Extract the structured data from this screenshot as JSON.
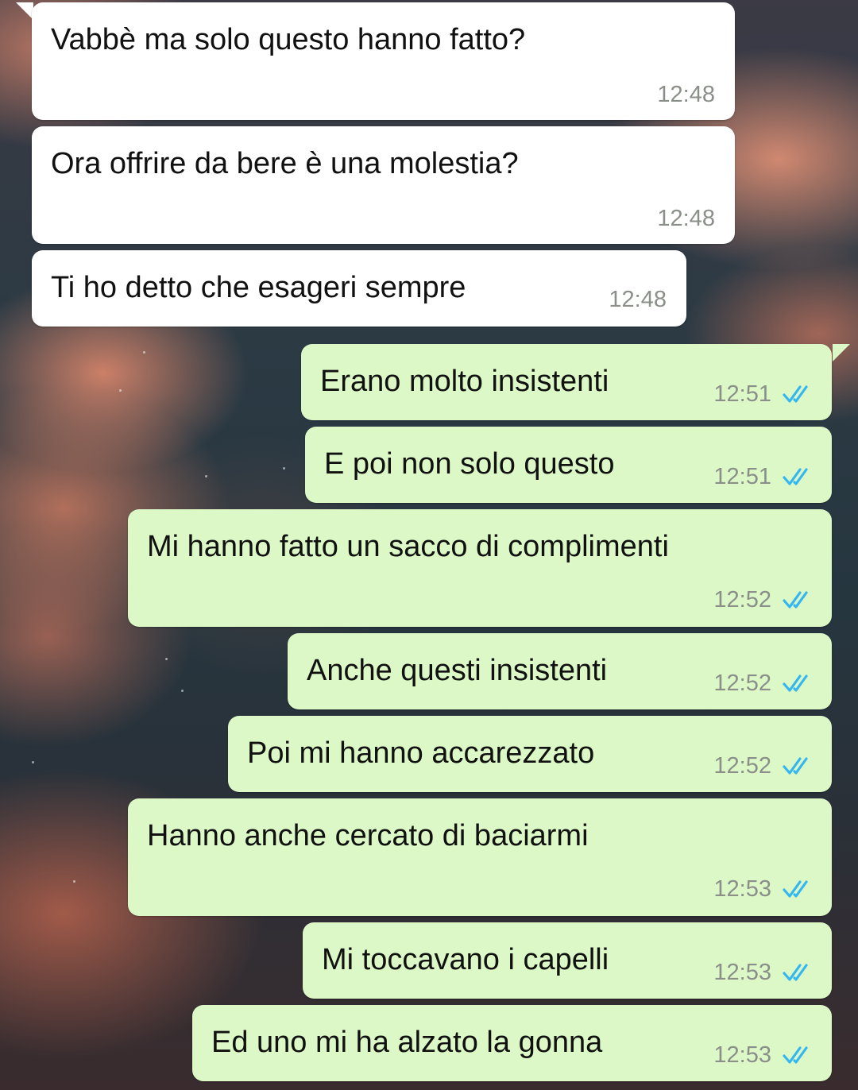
{
  "chat": {
    "messages": [
      {
        "direction": "incoming",
        "text": "Vabbè ma solo questo hanno fatto?",
        "time": "12:48"
      },
      {
        "direction": "incoming",
        "text": "Ora offrire da bere è una molestia?",
        "time": "12:48"
      },
      {
        "direction": "incoming",
        "text": "Ti ho detto che esageri sempre",
        "time": "12:48"
      },
      {
        "direction": "outgoing",
        "text": "Erano molto insistenti",
        "time": "12:51",
        "status": "read"
      },
      {
        "direction": "outgoing",
        "text": "E poi non solo questo",
        "time": "12:51",
        "status": "read"
      },
      {
        "direction": "outgoing",
        "text": "Mi hanno fatto un sacco di complimenti",
        "time": "12:52",
        "status": "read"
      },
      {
        "direction": "outgoing",
        "text": "Anche questi insistenti",
        "time": "12:52",
        "status": "read"
      },
      {
        "direction": "outgoing",
        "text": "Poi mi hanno accarezzato",
        "time": "12:52",
        "status": "read"
      },
      {
        "direction": "outgoing",
        "text": "Hanno anche cercato di baciarmi",
        "time": "12:53",
        "status": "read"
      },
      {
        "direction": "outgoing",
        "text": "Mi toccavano i capelli",
        "time": "12:53",
        "status": "read"
      },
      {
        "direction": "outgoing",
        "text": "Ed uno mi ha alzato la gonna",
        "time": "12:53",
        "status": "read"
      }
    ]
  },
  "colors": {
    "incoming_bubble": "#ffffff",
    "outgoing_bubble": "#dcf8c6",
    "read_ticks": "#34b7f1",
    "timestamp": "#8a8f8a"
  },
  "icons": {
    "read_receipt": "double-check-icon"
  }
}
